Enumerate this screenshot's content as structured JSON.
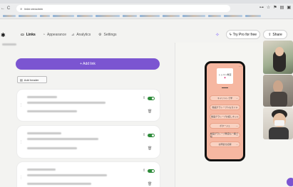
{
  "browser": {
    "url": "linktr.ee/admin",
    "nav": {
      "back": "←",
      "reload": "C"
    },
    "right_icons": [
      "⊶",
      "☆",
      "⚑",
      "▤",
      "▣"
    ]
  },
  "header": {
    "tabs": [
      {
        "label": "Links",
        "icon": "link-icon"
      },
      {
        "label": "Appearance",
        "icon": "appearance-icon"
      },
      {
        "label": "Analytics",
        "icon": "analytics-icon"
      },
      {
        "label": "Settings",
        "icon": "settings-icon"
      }
    ],
    "pro_label": "Try Pro for free",
    "share_label": "Share"
  },
  "editor": {
    "add_link_label": "+ Add link",
    "add_header_label": "Add header"
  },
  "preview": {
    "profile_title": "レッスン教室",
    "profile_sub": "◆",
    "buttons": [
      "キャリトレで学",
      "動画グラレーブ人もガイド",
      "動画グラレーブお話しネット",
      "ポタージュ",
      "動画グラレーブ教室も一緒で投",
      "お問合せ記録"
    ]
  },
  "colors": {
    "accent": "#7b55d1",
    "toggle_on": "#2e8b3a",
    "preview_bg": "#f6b7a1"
  }
}
